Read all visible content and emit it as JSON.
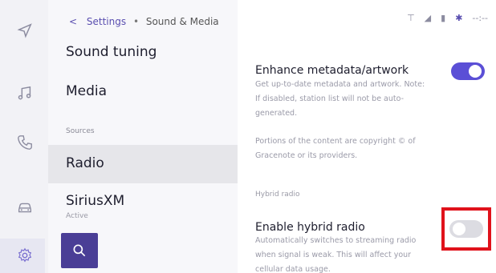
{
  "header": {
    "back": "<",
    "parent": "Settings",
    "separator": "•",
    "current": "Sound & Media"
  },
  "status": {
    "antenna": "⊤",
    "signal": "◢",
    "battery": "▮",
    "bluetooth": "✱",
    "time": "--:--"
  },
  "left_menu": {
    "items": [
      {
        "label": "Sound tuning"
      },
      {
        "label": "Media"
      },
      {
        "label": "Radio"
      },
      {
        "label": "SiriusXM",
        "subtitle": "Active"
      }
    ],
    "section_sources": "Sources"
  },
  "settings": {
    "enhance_metadata": {
      "title": "Enhance metadata/artwork",
      "description": "Get up-to-date metadata and artwork. Note: If disabled, station list will not be auto-generated.",
      "enabled": true
    },
    "copyright_note": "Portions of the content are copyright © of Gracenote or its providers.",
    "section_hybrid": "Hybrid radio",
    "hybrid_radio": {
      "title": "Enable hybrid radio",
      "description": "Automatically switches to streaming radio when signal is weak. This will affect your cellular data usage.",
      "enabled": false
    }
  },
  "colors": {
    "accent": "#5b4fd6",
    "search_button": "#4a3e96",
    "highlight": "#e0121b"
  }
}
